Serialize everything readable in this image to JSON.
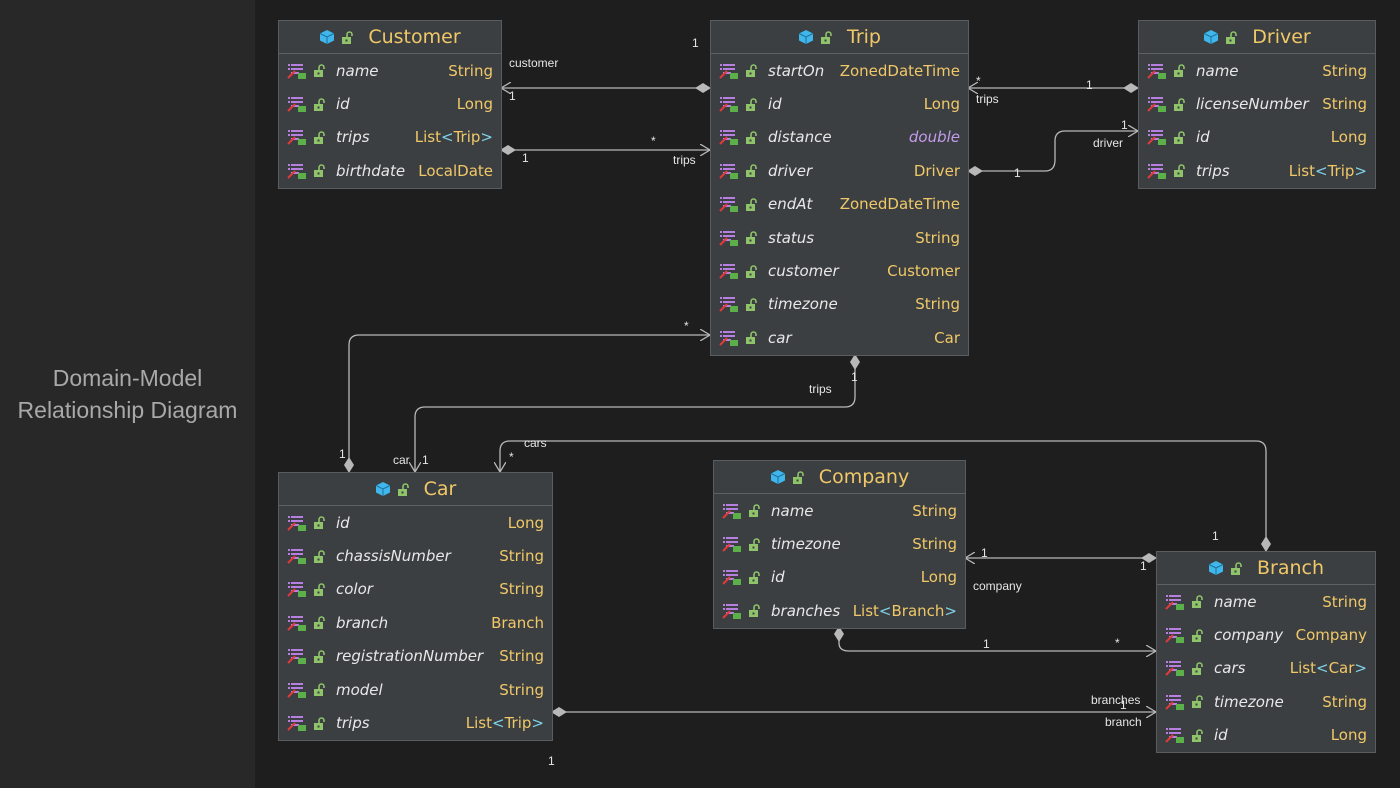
{
  "title_lines": [
    "Domain-Model",
    "Relationship Diagram"
  ],
  "colors": {
    "type": "#f0c868",
    "bracket": "#7fd3e8",
    "primitive": "#c39bec",
    "class_icon": "#3fb6ec",
    "lock_icon": "#8fc46a"
  },
  "entities": [
    {
      "id": "customer",
      "name": "Customer",
      "fields": [
        [
          "name",
          "String"
        ],
        [
          "id",
          "Long"
        ],
        [
          "trips",
          "List<Trip>"
        ],
        [
          "birthdate",
          "LocalDate"
        ]
      ]
    },
    {
      "id": "trip",
      "name": "Trip",
      "fields": [
        [
          "startOn",
          "ZonedDateTime"
        ],
        [
          "id",
          "Long"
        ],
        [
          "distance",
          "double"
        ],
        [
          "driver",
          "Driver"
        ],
        [
          "endAt",
          "ZonedDateTime"
        ],
        [
          "status",
          "String"
        ],
        [
          "customer",
          "Customer"
        ],
        [
          "timezone",
          "String"
        ],
        [
          "car",
          "Car"
        ]
      ]
    },
    {
      "id": "driver",
      "name": "Driver",
      "fields": [
        [
          "name",
          "String"
        ],
        [
          "licenseNumber",
          "String"
        ],
        [
          "id",
          "Long"
        ],
        [
          "trips",
          "List<Trip>"
        ]
      ]
    },
    {
      "id": "car",
      "name": "Car",
      "fields": [
        [
          "id",
          "Long"
        ],
        [
          "chassisNumber",
          "String"
        ],
        [
          "color",
          "String"
        ],
        [
          "branch",
          "Branch"
        ],
        [
          "registrationNumber",
          "String"
        ],
        [
          "model",
          "String"
        ],
        [
          "trips",
          "List<Trip>"
        ]
      ]
    },
    {
      "id": "company",
      "name": "Company",
      "fields": [
        [
          "name",
          "String"
        ],
        [
          "timezone",
          "String"
        ],
        [
          "id",
          "Long"
        ],
        [
          "branches",
          "List<Branch>"
        ]
      ]
    },
    {
      "id": "branch",
      "name": "Branch",
      "fields": [
        [
          "name",
          "String"
        ],
        [
          "company",
          "Company"
        ],
        [
          "cars",
          "List<Car>"
        ],
        [
          "timezone",
          "String"
        ],
        [
          "id",
          "Long"
        ]
      ]
    }
  ],
  "labels": [
    "customer",
    "1",
    "1",
    "1",
    "*",
    "trips",
    "*",
    "trips",
    "1",
    "1",
    "1",
    "driver",
    "*",
    "1",
    "1",
    "trips",
    "car",
    "1",
    "cars",
    "*",
    "1",
    "1",
    "1",
    "company",
    "1",
    "*",
    "branches",
    "1",
    "branch",
    "1"
  ]
}
